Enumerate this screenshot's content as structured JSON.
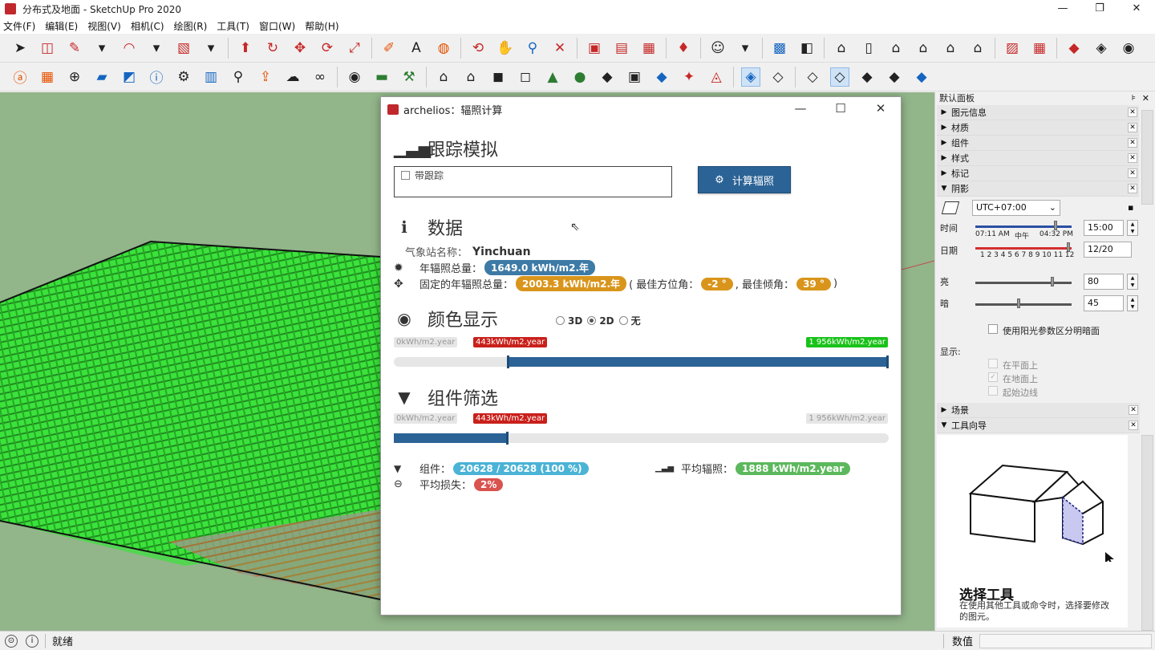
{
  "window": {
    "title": "分布式及地面 - SketchUp Pro 2020",
    "min": "—",
    "max": "❐",
    "close": "✕"
  },
  "menu": [
    "文件(F)",
    "编辑(E)",
    "视图(V)",
    "相机(C)",
    "绘图(R)",
    "工具(T)",
    "窗口(W)",
    "帮助(H)"
  ],
  "dialog": {
    "title": "archelios：辐照计算",
    "min": "—",
    "max": "☐",
    "close": "✕",
    "tracking_title": "跟踪模拟",
    "tracking_checkbox": "带跟踪",
    "calc_button": "计算辐照",
    "data_title": "数据",
    "station_label": "气象站名称：",
    "station_value": "Yinchuan",
    "annual_label": "年辐照总量：",
    "annual_value": "1649.0 kWh/m2.年",
    "fixed_label": "固定的年辐照总量：",
    "fixed_value": "2003.3 kWh/m2.年",
    "azimuth_label": "( 最佳方位角：",
    "azimuth_value": "-2 °",
    "tilt_label": ", 最佳倾角：",
    "tilt_value": "39 °",
    "close_paren": ")",
    "color_title": "颜色显示",
    "radio_3d": "3D",
    "radio_2d": "2D",
    "radio_none": "无",
    "color_scale": {
      "min": "0kWh/m2.year",
      "low": "443kWh/m2.year",
      "high": "1 956kWh/m2.year",
      "low_fraction": 0.23,
      "high_fraction": 1.0
    },
    "filter_title": "组件筛选",
    "filter_scale": {
      "min": "0kWh/m2.year",
      "value": "443kWh/m2.year",
      "max": "1 956kWh/m2.year",
      "value_fraction": 0.23
    },
    "components_label": "组件：",
    "components_value": "20628 / 20628 (100 %)",
    "avg_irr_label": "平均辐照：",
    "avg_irr_value": "1888 kWh/m2.year",
    "avg_loss_label": "平均损失：",
    "avg_loss_value": "2%"
  },
  "tray": {
    "title": "默认面板",
    "pin": "⊧",
    "close": "✕",
    "sections_top": [
      "图元信息",
      "材质",
      "组件",
      "样式",
      "标记"
    ],
    "shadow_title": "阴影",
    "utc": "UTC+07:00",
    "time_label": "时间",
    "time_start": "07:11 AM",
    "time_mid": "中午",
    "time_end": "04:32 PM",
    "time_value": "15:00",
    "time_fraction": 0.83,
    "date_label": "日期",
    "months": "1 2 3 4 5 6 7 8 9 10 11 12",
    "date_value": "12/20",
    "date_fraction": 0.97,
    "light_label": "亮",
    "light_value": "80",
    "light_fraction": 0.8,
    "dark_label": "暗",
    "dark_value": "45",
    "dark_fraction": 0.45,
    "use_sun_label": "使用阳光参数区分明暗面",
    "display_label": "显示:",
    "opt_faces": "在平面上",
    "opt_ground": "在地面上",
    "opt_edges": "起始边线",
    "scenes_title": "场景",
    "guide_title": "工具向导",
    "guide_heading": "选择工具",
    "guide_text": "在使用其他工具或命令时，选择要修改的图元。"
  },
  "status": {
    "ready": "就绪",
    "measure": "数值"
  }
}
